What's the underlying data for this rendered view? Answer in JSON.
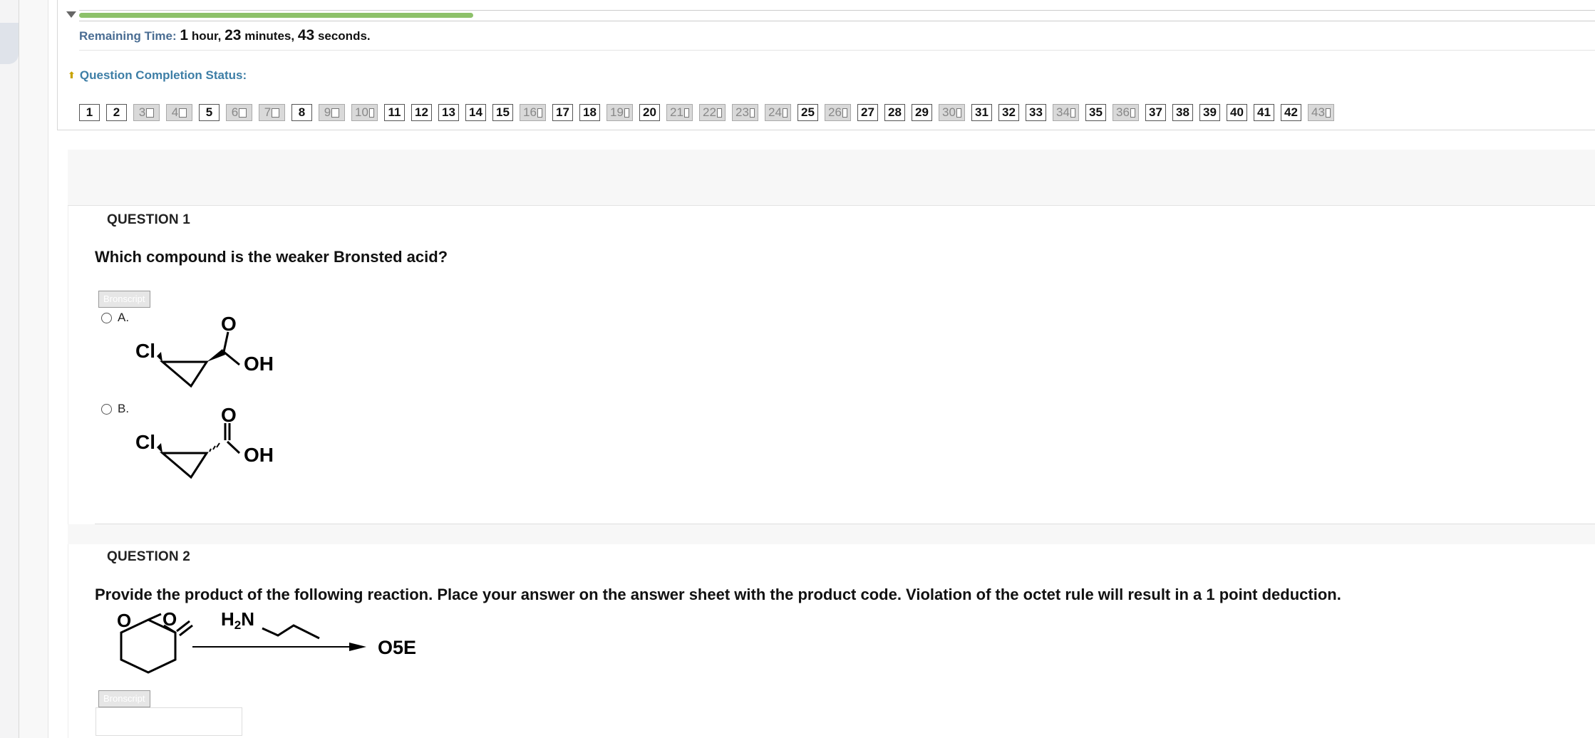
{
  "timer": {
    "label": "Remaining Time:",
    "hours": "1",
    "hour_unit": "hour,",
    "minutes": "23",
    "minute_unit": "minutes,",
    "seconds": "43",
    "second_unit": "seconds.",
    "progress_fraction": 0.26
  },
  "completion": {
    "label": "Question Completion Status:",
    "questions": [
      {
        "n": "1",
        "saved": false
      },
      {
        "n": "2",
        "saved": false
      },
      {
        "n": "3",
        "saved": true
      },
      {
        "n": "4",
        "saved": true
      },
      {
        "n": "5",
        "saved": false
      },
      {
        "n": "6",
        "saved": true
      },
      {
        "n": "7",
        "saved": true
      },
      {
        "n": "8",
        "saved": false
      },
      {
        "n": "9",
        "saved": true
      },
      {
        "n": "10",
        "saved": true
      },
      {
        "n": "11",
        "saved": false
      },
      {
        "n": "12",
        "saved": false
      },
      {
        "n": "13",
        "saved": false
      },
      {
        "n": "14",
        "saved": false
      },
      {
        "n": "15",
        "saved": false
      },
      {
        "n": "16",
        "saved": true
      },
      {
        "n": "17",
        "saved": false
      },
      {
        "n": "18",
        "saved": false
      },
      {
        "n": "19",
        "saved": true
      },
      {
        "n": "20",
        "saved": false
      },
      {
        "n": "21",
        "saved": true
      },
      {
        "n": "22",
        "saved": true
      },
      {
        "n": "23",
        "saved": true
      },
      {
        "n": "24",
        "saved": true
      },
      {
        "n": "25",
        "saved": false
      },
      {
        "n": "26",
        "saved": true
      },
      {
        "n": "27",
        "saved": false
      },
      {
        "n": "28",
        "saved": false
      },
      {
        "n": "29",
        "saved": false
      },
      {
        "n": "30",
        "saved": true
      },
      {
        "n": "31",
        "saved": false
      },
      {
        "n": "32",
        "saved": false
      },
      {
        "n": "33",
        "saved": false
      },
      {
        "n": "34",
        "saved": true
      },
      {
        "n": "35",
        "saved": false
      },
      {
        "n": "36",
        "saved": true
      },
      {
        "n": "37",
        "saved": false
      },
      {
        "n": "38",
        "saved": false
      },
      {
        "n": "39",
        "saved": false
      },
      {
        "n": "40",
        "saved": false
      },
      {
        "n": "41",
        "saved": false
      },
      {
        "n": "42",
        "saved": false
      },
      {
        "n": "43",
        "saved": true
      }
    ]
  },
  "question1": {
    "heading": "QUESTION 1",
    "text": "Which compound is the weaker Bronsted acid?",
    "tag": "Bronscript",
    "options": [
      {
        "label": "A.",
        "atoms": [
          "Cl",
          "O",
          "OH"
        ]
      },
      {
        "label": "B.",
        "atoms": [
          "Cl",
          "O",
          "OH"
        ]
      }
    ]
  },
  "question2": {
    "heading": "QUESTION 2",
    "text": "Provide the product of the following reaction.  Place your answer on the answer sheet with the product code. Violation of the octet rule will result in a 1 point deduction.",
    "tag": "Bronscript",
    "reagent": {
      "h": "H",
      "sub": "2",
      "n": "N"
    },
    "ring_atoms": [
      "O",
      "O"
    ],
    "product_code": "O5E"
  }
}
